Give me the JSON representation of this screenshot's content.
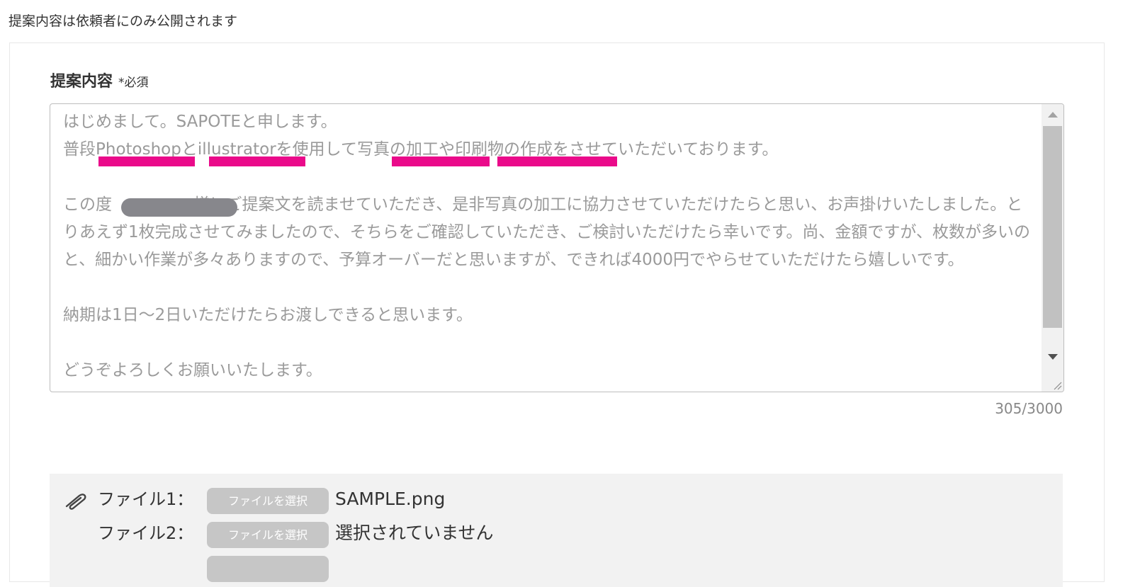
{
  "notice": "提案内容は依頼者にのみ公開されます",
  "proposal": {
    "label": "提案内容",
    "required": "*必須",
    "body": "はじめまして。SAPOTEと申します。\n普段Photoshopとillustratorを使用して写真の加工や印刷物の作成をさせていただいております。\n\nこの度　　　　　様にご提案文を読ませていただき、是非写真の加工に協力させていただけたらと思い、お声掛けいたしました。とりあえず1枚完成させてみましたので、そちらをご確認していただき、ご検討いただけたら幸いです。尚、金額ですが、枚数が多いのと、細かい作業が多々ありますので、予算オーバーだと思いますが、できれば4000円でやらせていただけたら嬉しいです。\n\n納期は1日〜2日いただけたらお渡しできると思います。\n\nどうぞよろしくお願いいたします。",
    "counter": "305/3000"
  },
  "files": [
    {
      "label": "ファイル1：",
      "button": "ファイルを選択",
      "status": "SAMPLE.png"
    },
    {
      "label": "ファイル2：",
      "button": "ファイルを選択",
      "status": "選択されていません"
    }
  ],
  "colors": {
    "highlight": "#ea0a8a",
    "redaction": "#87878c"
  },
  "icons": {
    "attachment": "paperclip-icon",
    "scroll_up": "triangle-up-icon",
    "scroll_down": "triangle-down-icon",
    "resize": "resize-grip-icon"
  }
}
